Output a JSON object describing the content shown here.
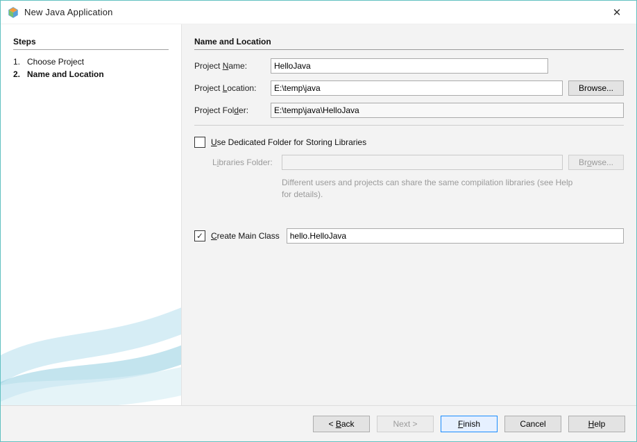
{
  "window": {
    "title": "New Java Application",
    "close_glyph": "✕"
  },
  "steps": {
    "header": "Steps",
    "items": [
      {
        "num": "1.",
        "label": "Choose Project",
        "current": false
      },
      {
        "num": "2.",
        "label": "Name and Location",
        "current": true
      }
    ]
  },
  "main": {
    "section_title": "Name and Location",
    "project_name": {
      "label": "Project Name:",
      "value": "HelloJava"
    },
    "project_location": {
      "label": "Project Location:",
      "value": "E:\\temp\\java",
      "browse": "Browse..."
    },
    "project_folder": {
      "label": "Project Folder:",
      "value": "E:\\temp\\java\\HelloJava"
    },
    "use_dedicated": {
      "checked": false,
      "label": "Use Dedicated Folder for Storing Libraries",
      "libraries_folder_label": "Libraries Folder:",
      "libraries_folder_value": "",
      "browse": "Browse...",
      "hint": "Different users and projects can share the same compilation libraries (see Help for details)."
    },
    "create_main_class": {
      "checked": true,
      "label": "Create Main Class",
      "value": "hello.HelloJava"
    }
  },
  "buttons": {
    "back": "< Back",
    "next": "Next >",
    "finish": "Finish",
    "cancel": "Cancel",
    "help": "Help"
  }
}
